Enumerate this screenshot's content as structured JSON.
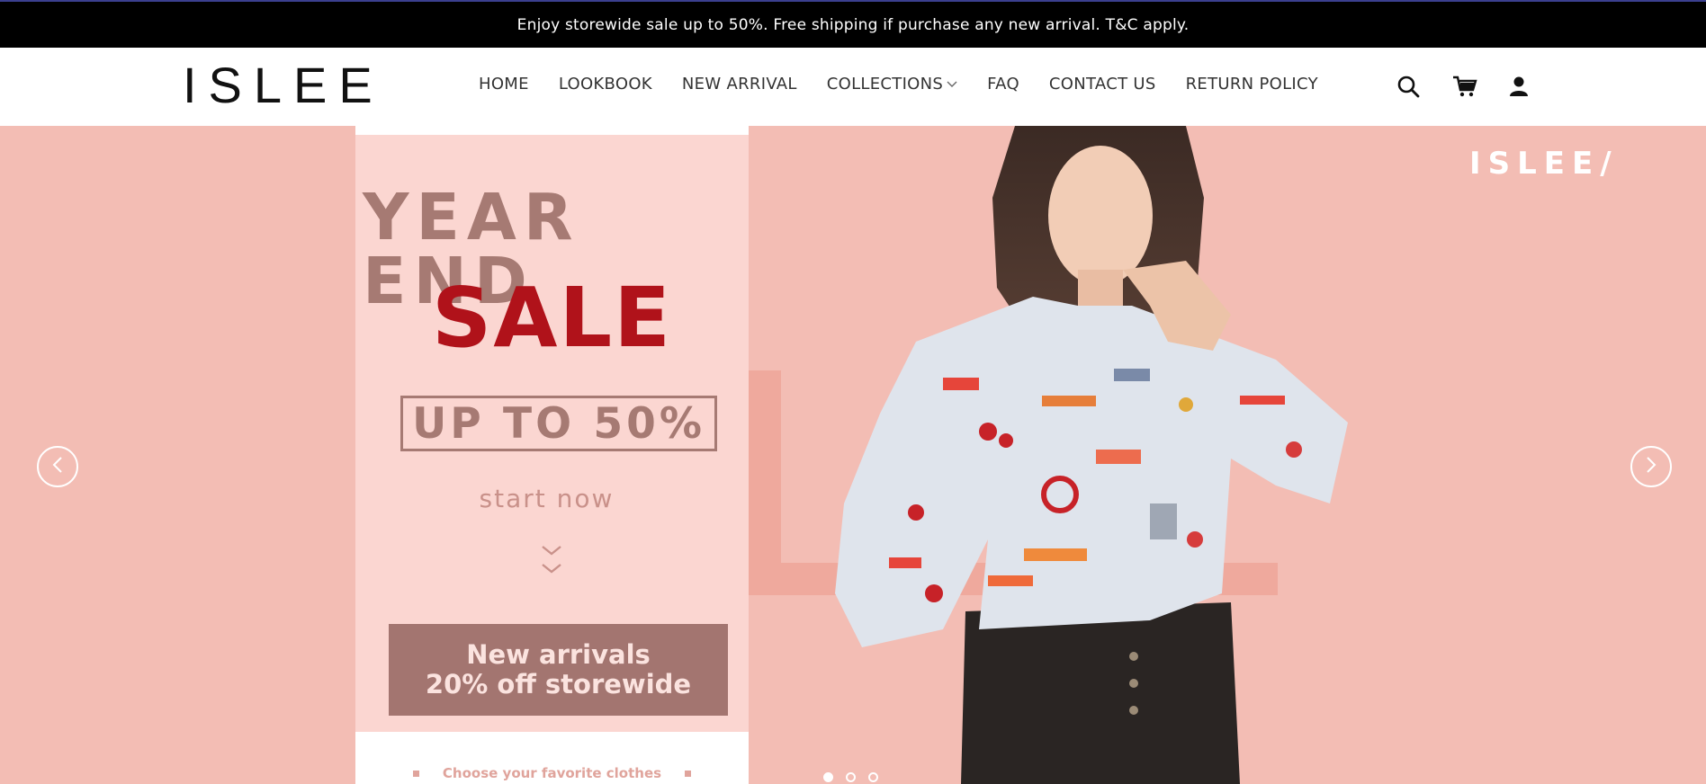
{
  "announcement": "Enjoy storewide sale up to 50%. Free shipping if purchase any new arrival. T&C apply.",
  "header": {
    "logo": "ISLEE",
    "nav": [
      {
        "label": "HOME"
      },
      {
        "label": "LOOKBOOK"
      },
      {
        "label": "NEW ARRIVAL"
      },
      {
        "label": "COLLECTIONS",
        "dropdown": true
      },
      {
        "label": "FAQ"
      },
      {
        "label": "CONTACT US"
      },
      {
        "label": "RETURN POLICY"
      }
    ],
    "icons": [
      "search-icon",
      "cart-icon",
      "user-icon"
    ]
  },
  "hero": {
    "headline_1": "YEAR END",
    "headline_2": "SALE",
    "badge": "UP TO 50%",
    "start": "start now",
    "cta_line_1": "New arrivals",
    "cta_line_2": "20% off storewide",
    "choose": "Choose your favorite clothes",
    "brand_mark": "ISLEE/",
    "slides_total": 3,
    "active_slide": 1,
    "colors": {
      "background": "#f3bdb4",
      "panel": "#fbd6d1",
      "sale_red": "#b0121a",
      "muted_brown": "#a67a73"
    }
  }
}
